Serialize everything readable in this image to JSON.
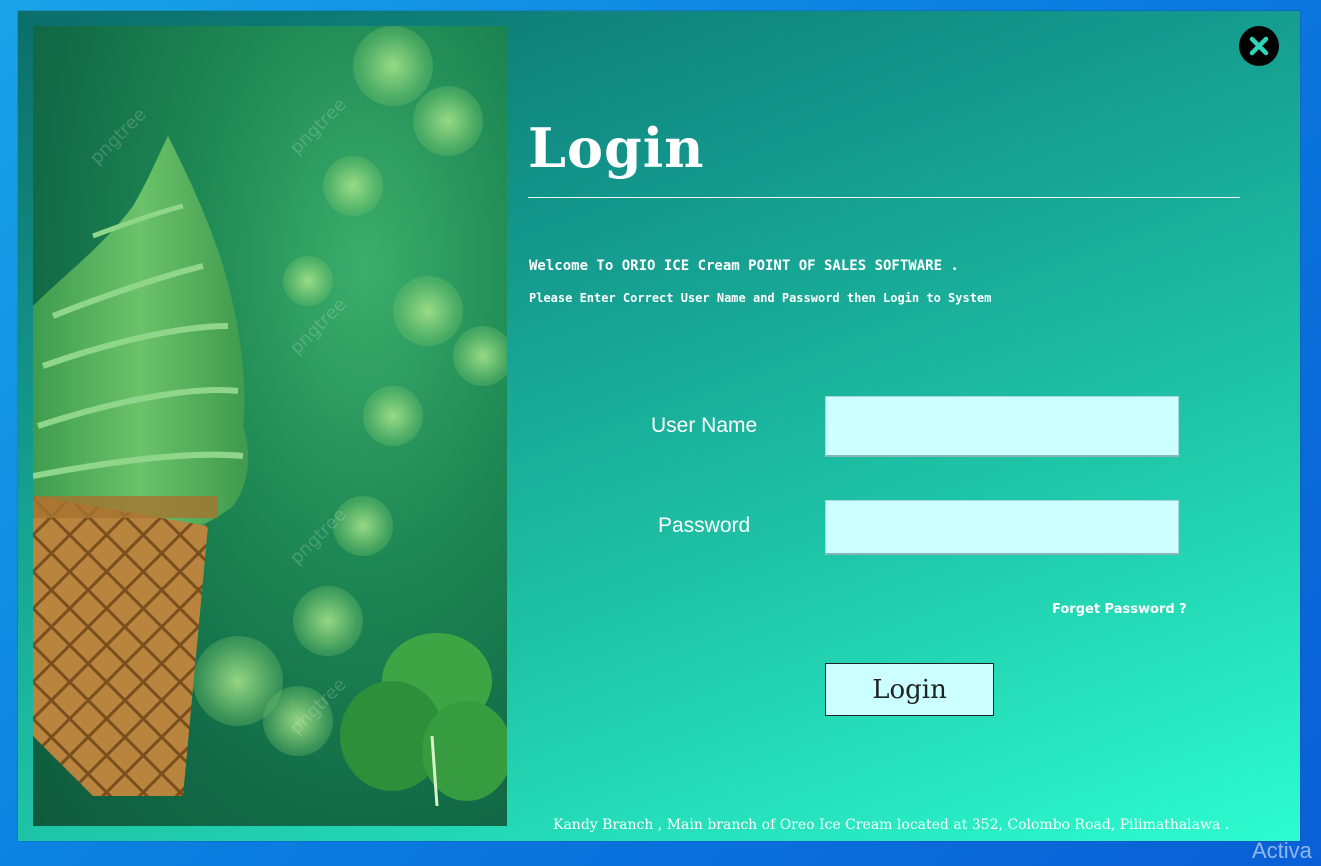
{
  "login": {
    "title": "Login",
    "welcome": "Welcome To ORIO ICE Cream POINT OF SALES SOFTWARE .",
    "instruction": "Please Enter Correct User Name and Password then Login to System",
    "username_label": "User Name",
    "username_value": "",
    "password_label": "Password",
    "password_value": "",
    "forgot_password": "Forget Password ?",
    "login_button": "Login",
    "footer": "Kandy Branch ,  Main branch of Oreo Ice Cream located at 352, Colombo  Road, Pilimathalawa ."
  },
  "image": {
    "watermark": "pngtree"
  },
  "os": {
    "activation_watermark": "Activa"
  },
  "icons": {
    "close": "close-icon"
  },
  "colors": {
    "input_bg": "#ccffff",
    "window_gradient_start": "#0b6e6a",
    "window_gradient_end": "#2dfcd0",
    "desktop": "#0b7fe0"
  }
}
